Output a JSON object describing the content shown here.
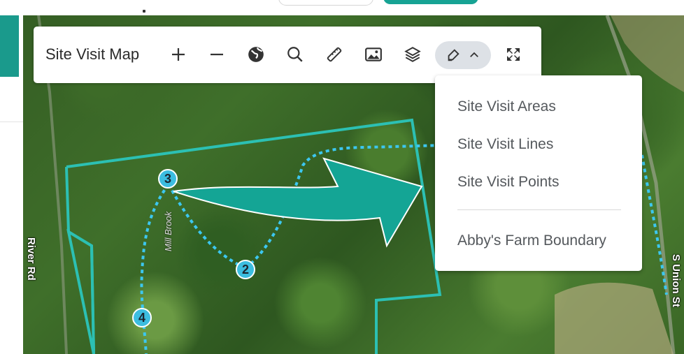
{
  "toolbar": {
    "title": "Site Visit Map",
    "tools": [
      {
        "name": "zoom-in-icon"
      },
      {
        "name": "zoom-out-icon"
      },
      {
        "name": "globe-icon"
      },
      {
        "name": "search-icon"
      },
      {
        "name": "ruler-icon"
      },
      {
        "name": "image-icon"
      },
      {
        "name": "layers-icon"
      },
      {
        "name": "edit-icon"
      },
      {
        "name": "chevron-up-icon"
      },
      {
        "name": "fullscreen-icon"
      }
    ]
  },
  "edit_menu": {
    "items": [
      "Site Visit Areas",
      "Site Visit Lines",
      "Site Visit Points"
    ],
    "boundary_item": "Abby's Farm Boundary"
  },
  "map": {
    "roads": [
      "River Rd",
      "S Union St"
    ],
    "water_label": "Mill Brook",
    "markers": [
      "3",
      "2",
      "4"
    ]
  },
  "colors": {
    "accent_teal": "#1a9a8c",
    "boundary": "#2cc0b3",
    "trail": "#3cc7f0",
    "arrow": "#14a595"
  }
}
